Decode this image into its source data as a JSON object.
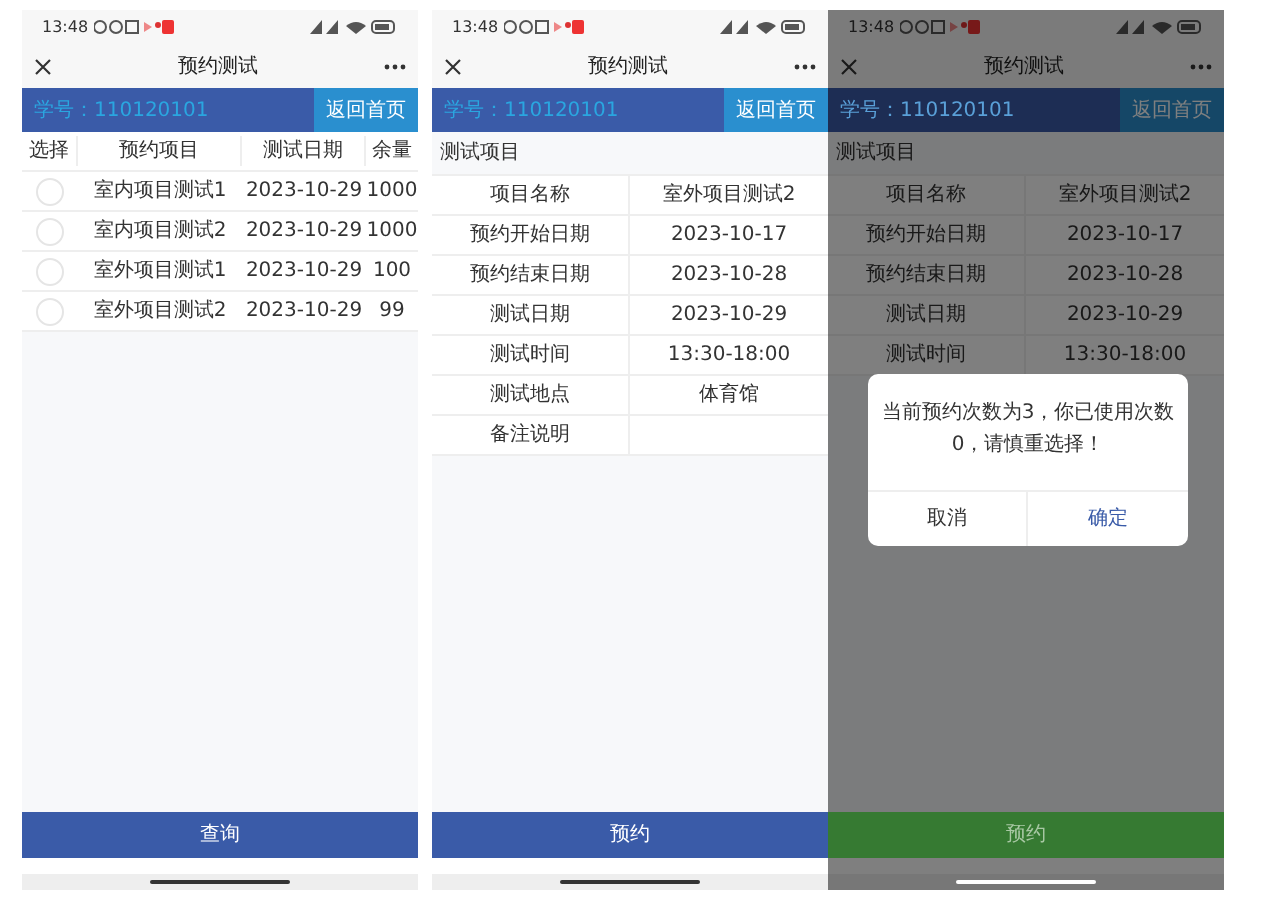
{
  "phones": [
    {
      "status_time": "13:48",
      "title": "预约测试",
      "student_id": "学号：110120101",
      "home_button": "返回首页",
      "dimmed": false,
      "content": {
        "kind": "table",
        "columns": [
          "选择",
          "预约项目",
          "测试日期",
          "余量"
        ],
        "rows": [
          {
            "selected": false,
            "name": "室内项目测试1",
            "date": "2023-10-29",
            "remaining": "1000"
          },
          {
            "selected": false,
            "name": "室内项目测试2",
            "date": "2023-10-29",
            "remaining": "1000"
          },
          {
            "selected": false,
            "name": "室外项目测试1",
            "date": "2023-10-29",
            "remaining": "100"
          },
          {
            "selected": false,
            "name": "室外项目测试2",
            "date": "2023-10-29",
            "remaining": "99"
          }
        ]
      },
      "bottom_button": {
        "label": "查询",
        "kind": "primary"
      }
    },
    {
      "status_time": "13:48",
      "title": "预约测试",
      "student_id": "学号：110120101",
      "home_button": "返回首页",
      "dimmed": false,
      "content": {
        "kind": "detail",
        "heading": "测试项目",
        "rows": [
          {
            "label": "项目名称",
            "value": "室外项目测试2"
          },
          {
            "label": "预约开始日期",
            "value": "2023-10-17"
          },
          {
            "label": "预约结束日期",
            "value": "2023-10-28"
          },
          {
            "label": "测试日期",
            "value": "2023-10-29"
          },
          {
            "label": "测试时间",
            "value": "13:30-18:00"
          },
          {
            "label": "测试地点",
            "value": "体育馆"
          },
          {
            "label": "备注说明"
          }
        ]
      },
      "bottom_button": {
        "label": "预约",
        "kind": "primary"
      }
    },
    {
      "status_time": "13:48",
      "title": "预约测试",
      "student_id": "学号：110120101",
      "home_button": "返回首页",
      "dimmed": true,
      "content": {
        "kind": "detail",
        "heading": "测试项目",
        "rows": [
          {
            "label": "项目名称",
            "value": "室外项目测试2"
          },
          {
            "label": "预约开始日期",
            "value": "2023-10-17"
          },
          {
            "label": "预约结束日期",
            "value": "2023-10-28"
          },
          {
            "label": "测试日期",
            "value": "2023-10-29"
          },
          {
            "label": "测试时间",
            "value": "13:30-18:00"
          }
        ]
      },
      "bottom_button": {
        "label": "预约",
        "kind": "success"
      },
      "dialog": {
        "message": "当前预约次数为3，你已使用次数0，请慎重选择！",
        "cancel": "取消",
        "confirm": "确定"
      }
    }
  ]
}
